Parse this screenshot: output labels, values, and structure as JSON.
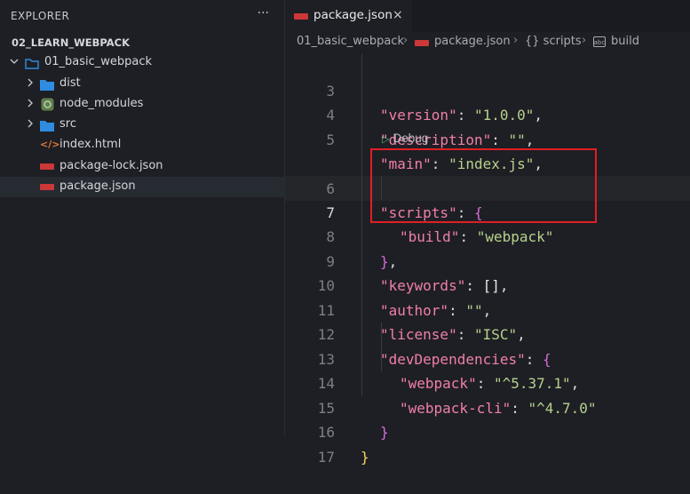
{
  "explorer": {
    "title": "EXPLORER",
    "more": "···",
    "root": "02_LEARN_WEBPACK",
    "folder": "01_basic_webpack",
    "items": [
      {
        "label": "dist",
        "icon": "folder-icon"
      },
      {
        "label": "node_modules",
        "icon": "gear-folder-icon"
      },
      {
        "label": "src",
        "icon": "folder-icon"
      },
      {
        "label": "index.html",
        "icon": "html-icon"
      },
      {
        "label": "package-lock.json",
        "icon": "npm-icon"
      },
      {
        "label": "package.json",
        "icon": "npm-icon"
      }
    ]
  },
  "tab": {
    "label": "package.json",
    "close": "×"
  },
  "breadcrumb": {
    "folder": "01_basic_webpack",
    "file": "package.json",
    "scripts": "{} scripts",
    "build": "build"
  },
  "editor": {
    "codelens": "Debug",
    "lines": [
      {
        "n": "3",
        "key": "\"version\"",
        "val": "\"1.0.0\"",
        "tail": ","
      },
      {
        "n": "4",
        "key": "\"description\"",
        "val": "\"\"",
        "tail": ","
      },
      {
        "n": "5",
        "key": "\"main\"",
        "val": "\"index.js\"",
        "tail": ","
      },
      {
        "n": "6",
        "key": "\"scripts\"",
        "val": "{",
        "tail": ""
      },
      {
        "n": "7",
        "key": "\"build\"",
        "val": "\"webpack\"",
        "tail": ""
      },
      {
        "n": "8",
        "key": "",
        "val": "}",
        "tail": ","
      },
      {
        "n": "9",
        "key": "\"keywords\"",
        "val": "[]",
        "tail": ","
      },
      {
        "n": "10",
        "key": "\"author\"",
        "val": "\"\"",
        "tail": ","
      },
      {
        "n": "11",
        "key": "\"license\"",
        "val": "\"ISC\"",
        "tail": ","
      },
      {
        "n": "12",
        "key": "\"devDependencies\"",
        "val": "{",
        "tail": ""
      },
      {
        "n": "13",
        "key": "\"webpack\"",
        "val": "\"^5.37.1\"",
        "tail": ","
      },
      {
        "n": "14",
        "key": "\"webpack-cli\"",
        "val": "\"^4.7.0\"",
        "tail": ""
      },
      {
        "n": "15",
        "key": "",
        "val": "}",
        "tail": ""
      },
      {
        "n": "16",
        "key": "",
        "val": "}",
        "tail": ""
      },
      {
        "n": "17",
        "key": "",
        "val": "",
        "tail": ""
      }
    ]
  },
  "colors": {
    "highlight_box": "#e01f26",
    "npm": "#cb3837",
    "folder": "#2f8ce0"
  }
}
